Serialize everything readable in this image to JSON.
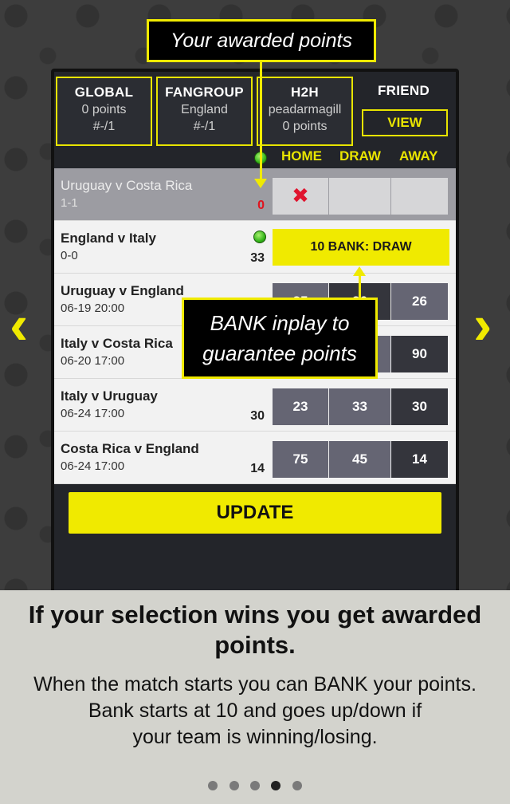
{
  "callouts": {
    "awarded": "Your awarded points",
    "bank_line1": "BANK inplay to",
    "bank_line2": "guarantee points"
  },
  "tabs": [
    {
      "title": "GLOBAL",
      "line1": "0 points",
      "line2": "#-/1"
    },
    {
      "title": "FANGROUP",
      "line1": "England",
      "line2": "#-/1"
    },
    {
      "title": "H2H",
      "line1": "peadarmagill",
      "line2": "0 points"
    },
    {
      "title": "FRIEND",
      "button": "VIEW"
    }
  ],
  "columns": {
    "home": "HOME",
    "draw": "DRAW",
    "away": "AWAY"
  },
  "matches": [
    {
      "teams": "Uruguay v Costa Rica",
      "when": "1-1",
      "points": "0",
      "status": "finished"
    },
    {
      "teams": "England v Italy",
      "when": "0-0",
      "points": "33",
      "bank": "10 BANK: DRAW"
    },
    {
      "teams": "Uruguay v England",
      "when": "06-19 20:00",
      "points": "",
      "home": "35",
      "draw": "26",
      "away": "26"
    },
    {
      "teams": "Italy v Costa Rica",
      "when": "06-20 17:00",
      "points": "",
      "home": "",
      "draw": "",
      "away": "90"
    },
    {
      "teams": "Italy v Uruguay",
      "when": "06-24 17:00",
      "points": "30",
      "home": "23",
      "draw": "33",
      "away": "30"
    },
    {
      "teams": "Costa Rica v England",
      "when": "06-24 17:00",
      "points": "14",
      "home": "75",
      "draw": "45",
      "away": "14"
    }
  ],
  "update_label": "UPDATE",
  "bottom": {
    "headline": "If your selection wins you get awarded points.",
    "body_line1": "When the match starts you can BANK your points.",
    "body_line2": "Bank starts at 10 and goes up/down if",
    "body_line3": "your team is winning/losing."
  },
  "pager": {
    "count": 5,
    "active": 4
  },
  "colors": {
    "accent": "#f0ea00",
    "loss": "#e0141e"
  }
}
